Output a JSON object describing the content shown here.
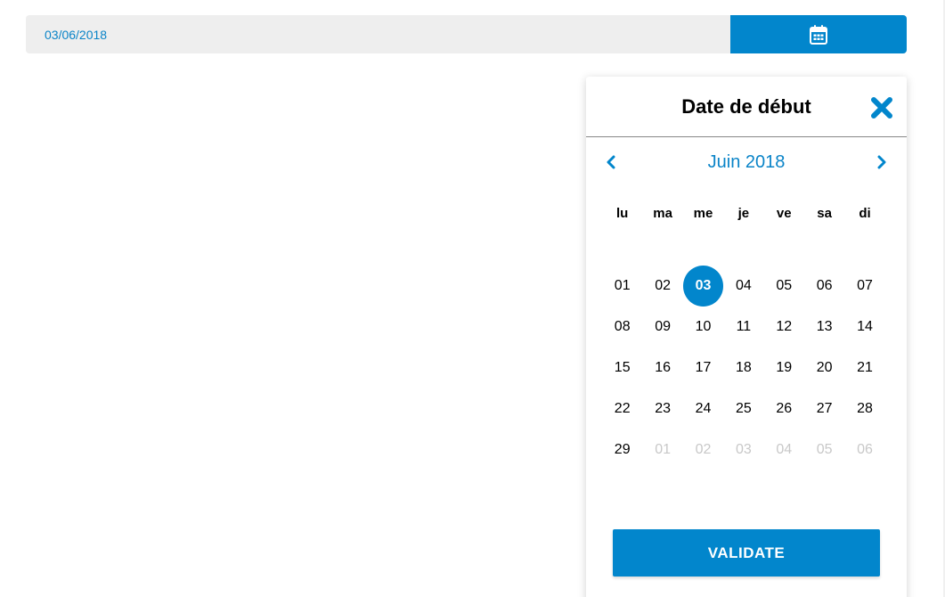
{
  "date_field": {
    "value": "03/06/2018",
    "calendar_icon": "calendar-icon",
    "accent": "#0286cc"
  },
  "picker": {
    "title": "Date de début",
    "close_icon": "close-icon",
    "month_label": "Juin 2018",
    "prev_icon": "chevron-left-icon",
    "next_icon": "chevron-right-icon",
    "weekdays": [
      "lu",
      "ma",
      "me",
      "je",
      "ve",
      "sa",
      "di"
    ],
    "weeks": [
      [
        {
          "d": "01"
        },
        {
          "d": "02"
        },
        {
          "d": "03",
          "selected": true
        },
        {
          "d": "04"
        },
        {
          "d": "05"
        },
        {
          "d": "06"
        },
        {
          "d": "07"
        }
      ],
      [
        {
          "d": "08"
        },
        {
          "d": "09"
        },
        {
          "d": "10"
        },
        {
          "d": "11"
        },
        {
          "d": "12"
        },
        {
          "d": "13"
        },
        {
          "d": "14"
        }
      ],
      [
        {
          "d": "15"
        },
        {
          "d": "16"
        },
        {
          "d": "17"
        },
        {
          "d": "18"
        },
        {
          "d": "19"
        },
        {
          "d": "20"
        },
        {
          "d": "21"
        }
      ],
      [
        {
          "d": "22"
        },
        {
          "d": "23"
        },
        {
          "d": "24"
        },
        {
          "d": "25"
        },
        {
          "d": "26"
        },
        {
          "d": "27"
        },
        {
          "d": "28"
        }
      ],
      [
        {
          "d": "29"
        },
        {
          "d": "01",
          "muted": true
        },
        {
          "d": "02",
          "muted": true
        },
        {
          "d": "03",
          "muted": true
        },
        {
          "d": "04",
          "muted": true
        },
        {
          "d": "05",
          "muted": true
        },
        {
          "d": "06",
          "muted": true
        }
      ]
    ],
    "validate_label": "VALIDATE",
    "selected_color": "#0286cc",
    "muted_color": "#c8c8c8"
  }
}
